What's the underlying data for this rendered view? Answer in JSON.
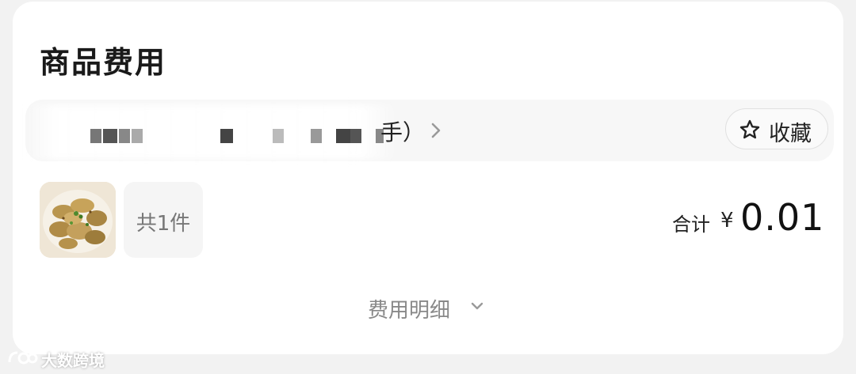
{
  "section": {
    "title": "商品费用"
  },
  "store": {
    "name_visible": "手）",
    "favorite_label": "收藏"
  },
  "order": {
    "item_count": "共1件",
    "total_label": "合计",
    "currency": "¥",
    "total_amount": "0.01"
  },
  "details": {
    "label": "费用明细"
  },
  "watermark": {
    "text": "大数跨境"
  },
  "icons": {
    "store_arrow": "chevron-right-icon",
    "favorite": "star-outline-icon",
    "details_toggle": "chevron-down-icon",
    "product": "food-dumplings-image",
    "watermark_logo": "logo-icon"
  }
}
